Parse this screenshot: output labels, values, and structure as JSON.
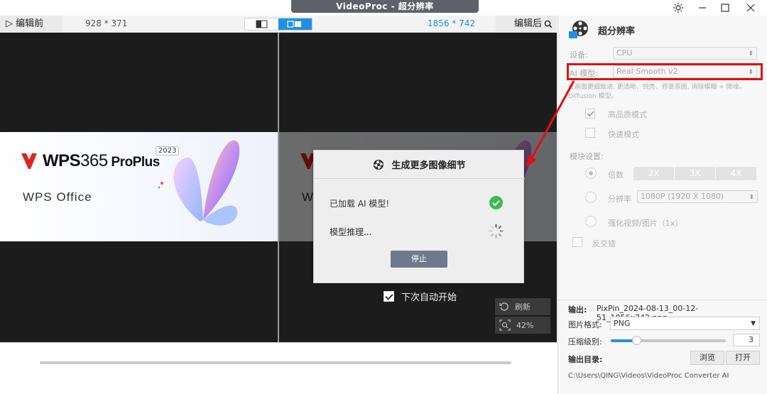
{
  "window": {
    "title": "VideoProc - 超分辨率",
    "controls": [
      "settings-icon",
      "minimize-icon",
      "maximize-icon",
      "close-icon"
    ]
  },
  "viewbar": {
    "before_label": "▷ 编辑前",
    "after_label": "编辑后",
    "before_resolution": "928 * 371",
    "after_resolution": "1856 * 742"
  },
  "preview": {
    "brand": "WPS",
    "brand_num": "365",
    "proplus": " ProPlus",
    "year": "2023",
    "office": "WPS Office",
    "office_partial": "W"
  },
  "dialog": {
    "title": "生成更多图像细节",
    "step1": "已加载 AI 模型!",
    "step2": "模型推理...",
    "stop_button": "停止"
  },
  "autostart_label": "下次自动开始",
  "tools": {
    "refresh": "刷新",
    "zoom": "42%"
  },
  "panel": {
    "title": "超分辨率",
    "device_label": "设备:",
    "device_value": "CPU",
    "model_label": "AI 模型:",
    "model_value": "Real Smooth v2",
    "model_desc": "让画面更细致清, 更清晰、锐亮、修复原图, 消除模糊 + 降噪。Diffusion 模型。",
    "hq_mode": "高品质模式",
    "fast_mode": "快速模式",
    "module_label": "模块设置:",
    "scale_label": "倍数",
    "scale_options": [
      "2X",
      "3X",
      "4X"
    ],
    "resolution_label": "分辨率",
    "resolution_value": "1080P (1920 X 1080)",
    "enhance_label": "强化视频/图片（1x）",
    "interlace_label": "反交错"
  },
  "output": {
    "output_label": "输出:",
    "file_name": "PixPin_2024-08-13_00-12-51_1856x742.png",
    "format_label": "图片格式:",
    "format_value": "PNG",
    "compress_label": "压缩级别:",
    "compress_value": "3",
    "compress_fraction": 0.22,
    "dir_label": "输出目录:",
    "browse_button": "浏览",
    "open_button": "打开",
    "path": "C:\\Users\\QING\\Videos\\VideoProc Converter AI"
  },
  "colors": {
    "accent": "#1e90e8",
    "highlight_red": "#e11010",
    "success": "#3cba54",
    "dialog_button": "#6e7a8c"
  }
}
